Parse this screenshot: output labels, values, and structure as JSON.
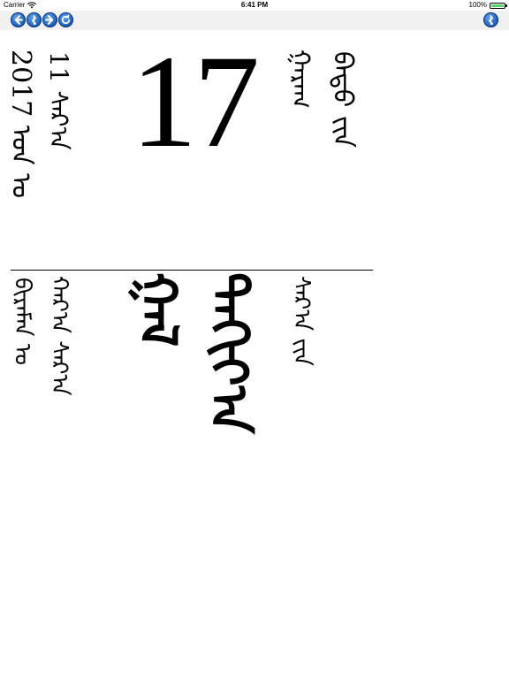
{
  "status_bar": {
    "carrier": "Carrier",
    "time": "6:41 PM",
    "battery_percent": "100%",
    "battery_level": 1.0
  },
  "toolbar": {
    "buttons": [
      {
        "name": "back-button",
        "icon": "arrow-left-icon"
      },
      {
        "name": "script-button",
        "icon": "mongolian-letter-icon"
      },
      {
        "name": "forward-button",
        "icon": "arrow-right-icon"
      },
      {
        "name": "refresh-button",
        "icon": "refresh-icon"
      }
    ],
    "right_button": {
      "name": "language-button",
      "icon": "mongolian-letter-icon"
    }
  },
  "calendar": {
    "year_line": "2017 ᠣᠨ ᠤ",
    "month_line": "11 ᠰᠠᠷ᠎ᠠ",
    "day": "17",
    "weekday_line_1": "ᠭᠠᠷᠠᠭ",
    "weekday_line_2": "ᠪᠠᠳᠤ ᠶ᠋ᠢᠨ",
    "lunar_line_1": "ᠪᠢᠷᠠᠮᠠᠨ ᠤ",
    "lunar_line_2": "ᠬᠠᠷ᠎ᠠ ᠰᠠᠷ᠎ᠠ",
    "big_text_1": "ᠭᠠᠯ",
    "big_text_2": "ᠲᠠᠬᠢᠶ᠎ᠠ",
    "right_line": "ᠰᠠᠷ᠎ᠠ ᠶ᠋ᠢᠨ"
  },
  "colors": {
    "toolbar_background": "#f1f1f1",
    "button_blue": "#1f63c4",
    "battery_green": "#4cd964"
  }
}
